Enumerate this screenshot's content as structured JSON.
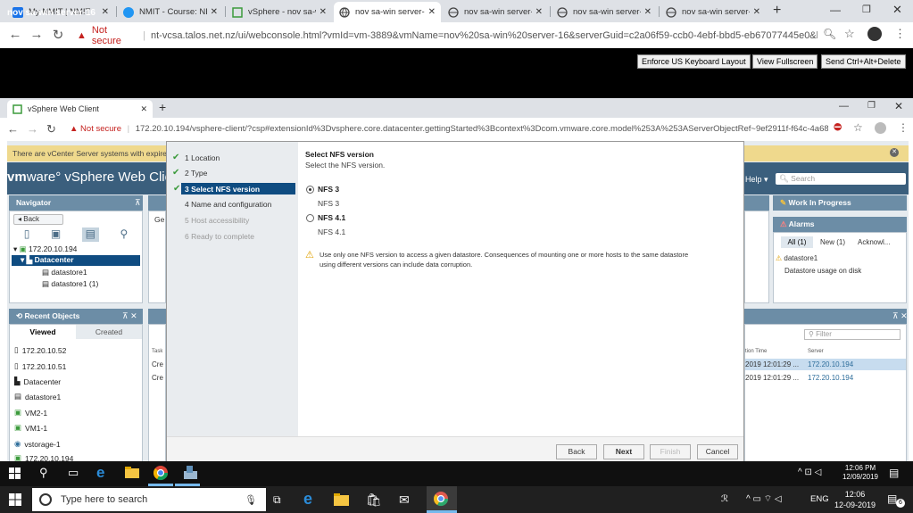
{
  "outer_browser": {
    "tabs": [
      {
        "label": "My NMIT | NMIT",
        "active": false
      },
      {
        "label": "NMIT - Course: NE",
        "active": false
      },
      {
        "label": "vSphere - nov sa-w",
        "active": false
      },
      {
        "label": "nov sa-win server-",
        "active": true
      },
      {
        "label": "nov sa-win server-",
        "active": false
      },
      {
        "label": "nov sa-win server-",
        "active": false
      },
      {
        "label": "nov sa-win server-",
        "active": false
      }
    ],
    "new_tab": "+",
    "not_secure": "Not secure",
    "url": "nt-vcsa.talos.net.nz/ui/webconsole.html?vmId=vm-3889&vmName=nov%20sa-win%20server-16&serverGuid=c2a06f59-ccb0-4ebf-bbd5-eb67077445e0&host..."
  },
  "console": {
    "title": "nov sa-win server-16",
    "buttons": [
      "Enforce US Keyboard Layout",
      "View Fullscreen",
      "Send Ctrl+Alt+Delete"
    ]
  },
  "inner_browser": {
    "tab_label": "vSphere Web Client",
    "not_secure": "Not secure",
    "url": "172.20.10.194/vsphere-client/?csp#extensionId%3Dvsphere.core.datacenter.gettingStarted%3Bcontext%3Dcom.vmware.core.model%253A%253AServerObjectRef~9ef2911f-f64c-4a68-..."
  },
  "vsphere": {
    "warning": "There are vCenter Server systems with expired",
    "logo_brand": "vm",
    "logo_suffix": "ware° vSphere Web Client",
    "help": "Help",
    "search_placeholder": "Search",
    "navigator": {
      "title": "Navigator",
      "back": "Back",
      "tree": [
        "172.20.10.194",
        "Datacenter",
        "datastore1",
        "datastore1 (1)"
      ]
    },
    "recent_objects": {
      "title": "Recent Objects",
      "tabs": [
        "Viewed",
        "Created"
      ],
      "items": [
        "172.20.10.52",
        "172.20.10.51",
        "Datacenter",
        "datastore1",
        "VM2-1",
        "VM1-1",
        "vstorage-1",
        "172.20.10.194"
      ]
    },
    "work_in_progress": "Work In Progress",
    "alarms": {
      "title": "Alarms",
      "tabs": [
        "All (1)",
        "New (1)",
        "Acknowl..."
      ],
      "item": "datastore1",
      "detail": "Datastore usage on disk"
    },
    "tasks": {
      "filter_placeholder": "Filter",
      "col_time": "tion Time",
      "col_server": "Server",
      "rows": [
        {
          "left": "Cre",
          "time": "2019 12:01:29 ...",
          "server": "172.20.10.194"
        },
        {
          "left": "Cre",
          "time": "2019 12:01:29 ...",
          "server": "172.20.10.194"
        }
      ],
      "task_col": "Task",
      "ge_tab": "Ge"
    }
  },
  "dialog": {
    "steps": [
      {
        "label": "1  Location",
        "state": "done"
      },
      {
        "label": "2  Type",
        "state": "done"
      },
      {
        "label": "3  Select NFS version",
        "state": "current"
      },
      {
        "label": "4  Name and configuration",
        "state": "next"
      },
      {
        "label": "5  Host accessibility",
        "state": "disabled"
      },
      {
        "label": "6  Ready to complete",
        "state": "disabled"
      }
    ],
    "heading": "Select NFS version",
    "subheading": "Select the NFS version.",
    "options": [
      {
        "label": "NFS 3",
        "desc": "NFS 3",
        "selected": true
      },
      {
        "label": "NFS 4.1",
        "desc": "NFS 4.1",
        "selected": false
      }
    ],
    "warning_line1": "Use only one NFS version to access a given datastore. Consequences of mounting one or more hosts to the same datastore",
    "warning_line2": "using different versions can include data corruption.",
    "buttons": {
      "back": "Back",
      "next": "Next",
      "finish": "Finish",
      "cancel": "Cancel"
    }
  },
  "vm_taskbar": {
    "time": "12:06 PM",
    "date": "12/09/2019"
  },
  "host_taskbar": {
    "search_placeholder": "Type here to search",
    "lang": "ENG",
    "time": "12:06",
    "date": "12-09-2019",
    "notif_count": "6"
  }
}
